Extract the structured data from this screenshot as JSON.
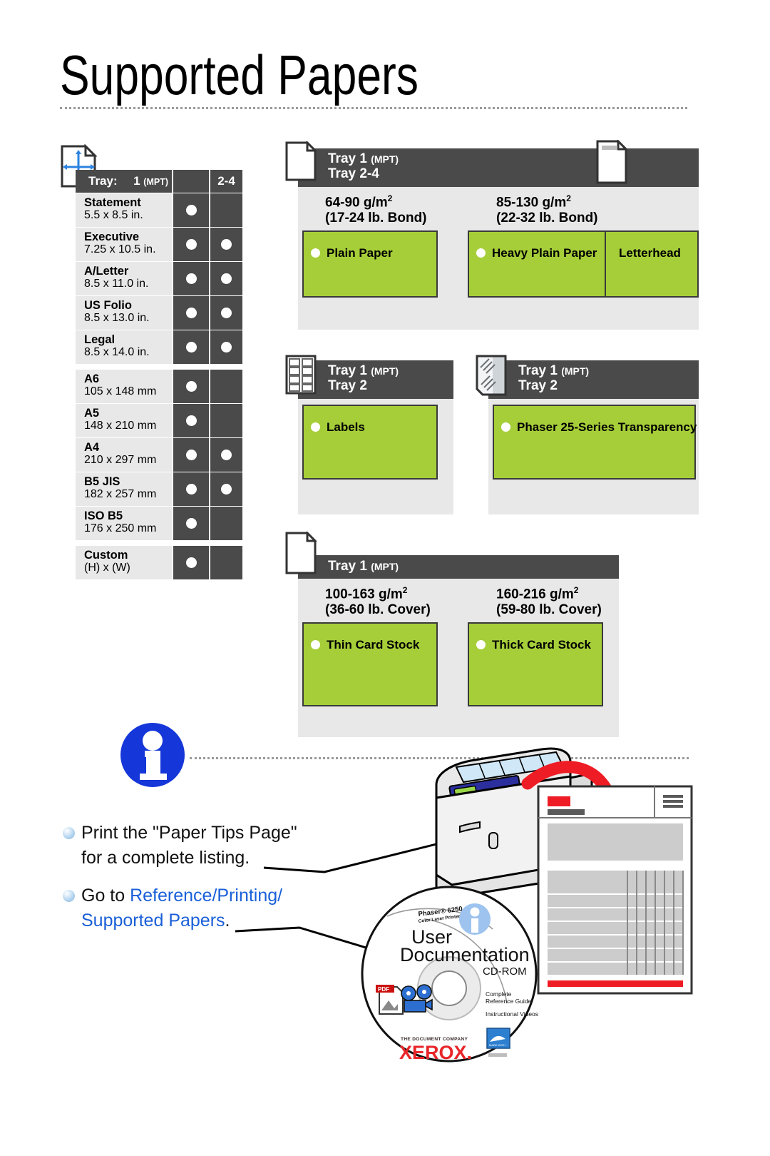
{
  "page": {
    "title": "Supported Papers"
  },
  "tray_table": {
    "icon": "page-size-arrows-icon",
    "header": {
      "label": "Tray:",
      "col1_num": "1",
      "col1_mpt": "(MPT)",
      "col2": "2-4"
    },
    "groups": [
      {
        "rows": [
          {
            "name": "Statement",
            "dim": "5.5 x 8.5 in.",
            "tray1": true,
            "tray24": false
          },
          {
            "name": "Executive",
            "dim": "7.25 x 10.5 in.",
            "tray1": true,
            "tray24": true
          },
          {
            "name": "A/Letter",
            "dim": "8.5 x 11.0 in.",
            "tray1": true,
            "tray24": true
          },
          {
            "name": "US Folio",
            "dim": "8.5 x 13.0 in.",
            "tray1": true,
            "tray24": true
          },
          {
            "name": "Legal",
            "dim": "8.5 x 14.0 in.",
            "tray1": true,
            "tray24": true
          }
        ]
      },
      {
        "rows": [
          {
            "name": "A6",
            "dim": "105 x 148 mm",
            "tray1": true,
            "tray24": false
          },
          {
            "name": "A5",
            "dim": "148 x 210 mm",
            "tray1": true,
            "tray24": false
          },
          {
            "name": "A4",
            "dim": "210 x 297 mm",
            "tray1": true,
            "tray24": true
          },
          {
            "name": "B5 JIS",
            "dim": "182 x 257 mm",
            "tray1": true,
            "tray24": true
          },
          {
            "name": "ISO B5",
            "dim": "176 x 250 mm",
            "tray1": true,
            "tray24": false
          }
        ]
      },
      {
        "rows": [
          {
            "name": "Custom",
            "dim": "(H) x (W)",
            "tray1": true,
            "tray24": false
          }
        ]
      }
    ]
  },
  "panels": [
    {
      "id": "plain-paper-panel",
      "icon": "plain-page-icon",
      "icon_right": "plain-page-icon",
      "head_lines": [
        "Tray 1",
        "Tray 2-4"
      ],
      "head_mpt": "(MPT)",
      "weights": [
        {
          "line1": "64-90 g/m2",
          "line1_base": "64-90 g/m",
          "line1_sup": "2",
          "line2": "(17-24 lb. Bond)"
        },
        {
          "line1": "85-130 g/m2",
          "line1_base": "85-130 g/m",
          "line1_sup": "2",
          "line2": "(22-32 lb. Bond)"
        }
      ],
      "media": [
        {
          "label": "Plain Paper",
          "dot": true
        },
        {
          "label": "Heavy Plain Paper",
          "dot": true
        },
        {
          "label": "Letterhead",
          "dot": false
        }
      ]
    },
    {
      "id": "labels-panel",
      "icon": "labels-sheet-icon",
      "head_lines": [
        "Tray 1",
        "Tray 2"
      ],
      "head_mpt": "(MPT)",
      "media": [
        {
          "label": "Labels",
          "dot": true
        }
      ]
    },
    {
      "id": "transparency-panel",
      "icon": "transparency-sheet-icon",
      "head_lines": [
        "Tray 1",
        "Tray 2"
      ],
      "head_mpt": "(MPT)",
      "media": [
        {
          "label": "Phaser 25-Series Transparency",
          "dot": true
        }
      ]
    },
    {
      "id": "card-stock-panel",
      "icon": "plain-page-icon",
      "head_lines": [
        "Tray 1"
      ],
      "head_mpt": "(MPT)",
      "weights": [
        {
          "line1_base": "100-163 g/m",
          "line1_sup": "2",
          "line2": "(36-60 lb. Cover)"
        },
        {
          "line1_base": "160-216 g/m",
          "line1_sup": "2",
          "line2": "(59-80 lb. Cover)"
        }
      ],
      "media": [
        {
          "label": "Thin Card Stock",
          "dot": true
        },
        {
          "label": "Thick Card Stock",
          "dot": true
        }
      ]
    }
  ],
  "info": {
    "icon": "info-circle-icon",
    "bullets": [
      {
        "line1": "Print the \"Paper Tips Page\"",
        "line2": "for a complete listing."
      },
      {
        "pre": "Go to ",
        "link1": "Reference/Printing/",
        "link2": "Supported Papers",
        "post": "."
      }
    ]
  },
  "artwork": {
    "printer": "phaser-printer-illustration",
    "arrow": "red-curved-arrow-icon",
    "printed_page": "paper-tips-page-sample",
    "cd": {
      "product_line1": "Phaser® 6250",
      "product_line2": "Color Laser Printer",
      "title_line1": "User",
      "title_line2": "Documentation",
      "media_type": "CD-ROM",
      "feature1": "Complete",
      "feature1b": "Reference Guide",
      "feature2": "Instructional Videos",
      "brand_tag": "THE DOCUMENT COMPANY",
      "brand": "XEROX",
      "brand_dot": ".",
      "icons": [
        "pdf-file-icon",
        "video-projector-icon",
        "made-with-macromedia-badge",
        "info-circle-icon"
      ]
    }
  },
  "colors": {
    "header_gray": "#4a4a4a",
    "row_gray": "#e8e8e8",
    "green": "#a6ce39",
    "blue_link": "#1a5fd8",
    "info_blue": "#1536d8",
    "red": "#ee1c24",
    "xerox_red": "#e8262a"
  }
}
